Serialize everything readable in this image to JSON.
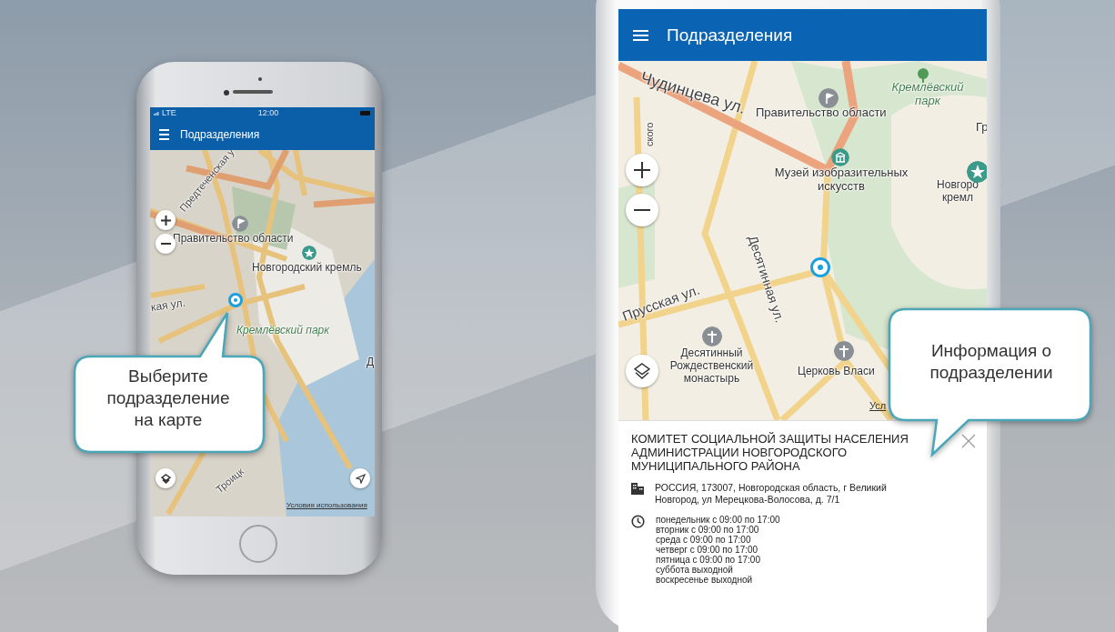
{
  "left_phone": {
    "status_bar": {
      "carrier": "LTE",
      "time": "12:00"
    },
    "app_bar": {
      "title": "Подразделения"
    },
    "map": {
      "labels": [
        {
          "text": "Предтеченская у",
          "kind": "street"
        },
        {
          "text": "Правительство области",
          "kind": "place"
        },
        {
          "text": "Новгородский кремль",
          "kind": "place"
        },
        {
          "text": "кая ул.",
          "kind": "street"
        },
        {
          "text": "Кремлёвский парк",
          "kind": "park"
        },
        {
          "text": "Д",
          "kind": "place"
        },
        {
          "text": "Троицк",
          "kind": "street"
        }
      ],
      "terms_link": "Условия использования"
    }
  },
  "left_callout": {
    "text": "Выберите подразделение на карте"
  },
  "right_phone": {
    "app_bar": {
      "title": "Подразделения"
    },
    "map": {
      "labels": [
        {
          "text": "Чудинцева ул.",
          "kind": "street"
        },
        {
          "text": "Правительство области",
          "kind": "place"
        },
        {
          "text": "Кремлёвский парк",
          "kind": "park"
        },
        {
          "text": "Гр",
          "kind": "place"
        },
        {
          "text": "Музей изобразительных искусств",
          "kind": "place"
        },
        {
          "text": "Новгоро кремл",
          "kind": "place"
        },
        {
          "text": "Десятинная ул.",
          "kind": "street"
        },
        {
          "text": "Прусская ул.",
          "kind": "street"
        },
        {
          "text": "Десятинный Рождественский монастырь",
          "kind": "place"
        },
        {
          "text": "Церковь Власи",
          "kind": "place"
        },
        {
          "text": "ского",
          "kind": "street"
        }
      ],
      "terms_link": "Усл"
    },
    "info_panel": {
      "title": "КОМИТЕТ СОЦИАЛЬНОЙ ЗАЩИТЫ НАСЕЛЕНИЯ АДМИНИСТРАЦИИ НОВГОРОДСКОГО МУНИЦИПАЛЬНОГО РАЙОНА",
      "address": "РОССИЯ, 173007, Новгородская область, г Великий Новгород, ул Мерецкова-Волосова, д. 7/1",
      "hours": [
        "понедельник с 09:00 по 17:00",
        "вторник с 09:00 по 17:00",
        "среда с 09:00 по 17:00",
        "четверг с 09:00 по 17:00",
        "пятница с 09:00 по 17:00",
        "суббота выходной",
        "воскресенье выходной"
      ]
    }
  },
  "right_callout": {
    "text": "Информация о подразделении"
  }
}
